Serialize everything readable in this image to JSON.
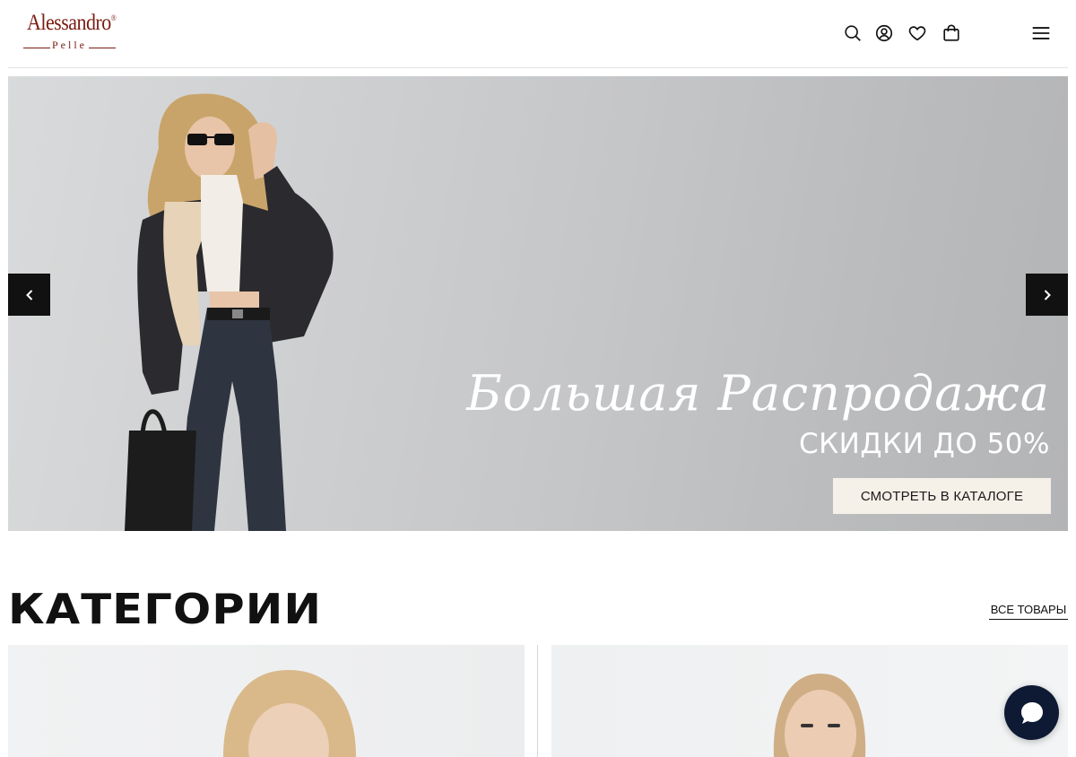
{
  "header": {
    "logo_main": "Alessandro",
    "logo_reg": "®",
    "logo_sub": "Pelle",
    "icons": [
      "search-icon",
      "user-icon",
      "heart-icon",
      "bag-icon",
      "menu-icon"
    ]
  },
  "hero": {
    "title": "Большая Распродажа",
    "subtitle": "СКИДКИ ДО 50%",
    "cta_label": "СМОТРЕТЬ В КАТАЛОГЕ",
    "prev_icon": "chevron-left-icon",
    "next_icon": "chevron-right-icon"
  },
  "categories": {
    "title": "КАТЕГОРИИ",
    "all_link": "ВСЕ ТОВАРЫ"
  },
  "colors": {
    "logo": "#7a1c12",
    "arrow_bg": "#111111",
    "cta_bg": "#f5f0e8",
    "chat_bg": "#0e1a33"
  },
  "chat": {
    "icon": "chat-bubble-icon"
  }
}
